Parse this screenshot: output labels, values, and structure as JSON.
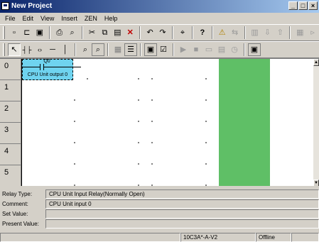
{
  "window": {
    "title": "New Project"
  },
  "menu": [
    "File",
    "Edit",
    "View",
    "Insert",
    "ZEN",
    "Help"
  ],
  "toolbar1": [
    {
      "icon": "new-file-icon",
      "glyph": "▫"
    },
    {
      "icon": "open-folder-icon",
      "glyph": "📂"
    },
    {
      "icon": "save-icon",
      "glyph": "▣"
    },
    {
      "icon": "print-icon",
      "glyph": "⎙"
    },
    {
      "icon": "print-preview-icon",
      "glyph": "⌕"
    },
    {
      "icon": "cut-icon",
      "glyph": "✂"
    },
    {
      "icon": "copy-icon",
      "glyph": "⧉"
    },
    {
      "icon": "paste-icon",
      "glyph": "▤"
    },
    {
      "icon": "delete-icon",
      "glyph": "✕"
    },
    {
      "icon": "undo-icon",
      "glyph": "↶"
    },
    {
      "icon": "redo-icon",
      "glyph": "↷"
    },
    {
      "icon": "find-icon",
      "glyph": "⌖"
    },
    {
      "icon": "help-icon",
      "glyph": "?"
    },
    {
      "icon": "warning-icon",
      "glyph": "⚠"
    },
    {
      "icon": "transfer-icon",
      "glyph": "⇆"
    },
    {
      "icon": "compare-icon",
      "glyph": "▥"
    },
    {
      "icon": "download-icon",
      "glyph": "⇩"
    },
    {
      "icon": "upload-icon",
      "glyph": "⇧"
    },
    {
      "icon": "monitor-icon",
      "glyph": "▦"
    },
    {
      "icon": "run-icon",
      "glyph": "▹"
    }
  ],
  "toolbar2": [
    {
      "icon": "select-pointer-icon",
      "glyph": "↖"
    },
    {
      "icon": "contact-icon",
      "glyph": "┤├"
    },
    {
      "icon": "coil-icon",
      "glyph": "( )"
    },
    {
      "icon": "horizontal-line-icon",
      "glyph": "─"
    },
    {
      "icon": "vertical-line-icon",
      "glyph": "│"
    },
    {
      "icon": "zoom-in-icon",
      "glyph": "⌕"
    },
    {
      "icon": "zoom-out-icon",
      "glyph": "🔍"
    },
    {
      "icon": "grid-icon",
      "glyph": "▦"
    },
    {
      "icon": "properties-icon",
      "glyph": "☰"
    },
    {
      "icon": "io-comment-icon",
      "glyph": "▣"
    },
    {
      "icon": "check-icon",
      "glyph": "☑"
    },
    {
      "icon": "play-icon",
      "glyph": "▶"
    },
    {
      "icon": "stop-icon",
      "glyph": "■"
    },
    {
      "icon": "window-icon",
      "glyph": "▭"
    },
    {
      "icon": "list-icon",
      "glyph": "▤"
    },
    {
      "icon": "clock-icon",
      "glyph": "◷"
    },
    {
      "icon": "simulation-icon",
      "glyph": "▣"
    }
  ],
  "ladder": {
    "row_numbers": [
      "0",
      "1",
      "2",
      "3",
      "4",
      "5"
    ],
    "contact": {
      "address": "Q0",
      "comment": "CPU Unit output 0"
    }
  },
  "info": {
    "relay_type_label": "Relay Type:",
    "relay_type_value": "CPU Unit Input Relay(Normally Open)",
    "comment_label": "Comment:",
    "comment_value": "CPU Unit input 0",
    "set_value_label": "Set Value:",
    "set_value_value": "",
    "present_value_label": "Present Value:",
    "present_value_value": ""
  },
  "status": {
    "model": "10C3A*-A-V2",
    "connection": "Offline"
  },
  "colors": {
    "output_column": "#5fbf66",
    "selected_cell": "#6fd3ef",
    "title_bar": "#0a246a"
  }
}
